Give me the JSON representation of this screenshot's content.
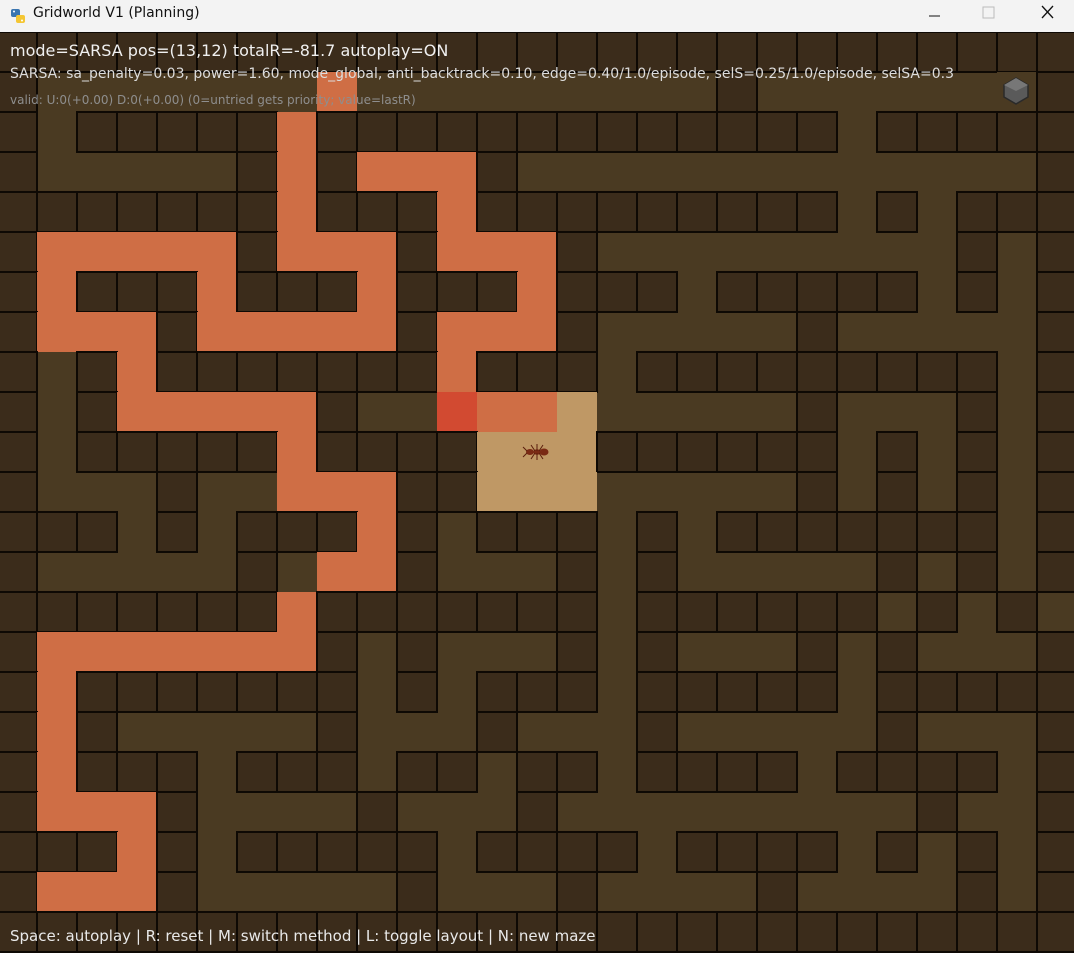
{
  "window": {
    "title": "Gridworld V1 (Planning)",
    "controls": [
      "minimize-icon",
      "maximize-icon",
      "close-icon"
    ]
  },
  "hud": {
    "line1": "mode=SARSA  pos=(13,12)  totalR=-81.7  autoplay=ON",
    "line2": "SARSA: sa_penalty=0.03, power=1.60, mode_global, anti_backtrack=0.10, edge=0.40/1.0/episode, selS=0.25/1.0/episode, selSA=0.3",
    "line3": "valid: U:0(+0.00)  D:0(+0.00)  (0=untried gets priority; value=lastR)"
  },
  "footer": "Space: autoplay  |  R: reset  |  M: switch method  |  L: toggle layout  |  N: new maze",
  "colors": {
    "floor": "#4a3a22",
    "wall": "#3b2c1b",
    "wall_border": "#0e0904",
    "path": "#cf6e45",
    "current_cell": "#d24a31",
    "explored": "#bf9865",
    "unexplored_wall": "#c59b6a"
  },
  "agent": {
    "icon": "ant-icon",
    "pos": [
      13,
      12
    ]
  },
  "maze": {
    "cols": 27,
    "rows": 23,
    "map": [
      "WWWWWWWWWWWWWWWWWWWWWWWWWWW",
      "W.......P.........W......eW",
      "W.WWWWWPWWWWWWWWWWWWW.WWWWW",
      "W.....WPWPPPW.............W",
      "WWWWWWWPWWWPWWWWWWWWW.W.WWW",
      "WPPPPPWPPPWPPPW.........W.W",
      "WPWWWPWWWPWWWPWWW.WWWWW.W.W",
      "WPPPWPPPPPWPPPW.....W.....W",
      "W.WPWWWWWWWPWWW.WWWWWWWWW.W",
      "W.WPPPPPW..XPPE.....W...W.W",
      "W.WWWWWPWWWWEAEWWWWWW.W.W.W",
      "W...W..PPPWWEEE.....W.W.W.W",
      "WWW.W.WWWPW.WWW.W.WWWWWWW.W",
      "W.....W.PPW...W.W.....W.W.W",
      "WWWWWWWPWWWWWWW.WWWWWW.W.W",
      "WPPPPPPPW.W...W.W...W.W...W",
      "WPWWWWWWW.W.WWW.WWWWW.WWWWW",
      "WPW.....W...W...W.....W...W",
      "WPWWW.WWW.WW.WW.WWWW.WWWW.W",
      "WPPPW....W...W.........W..W",
      "WWWPW.WWWWW.WWWW.WWWW.W.W.W",
      "WPPPW.....W...W....W....W.W",
      "WWWWWWWWWWWWWWWWWWWWWWWWWWW"
    ]
  }
}
